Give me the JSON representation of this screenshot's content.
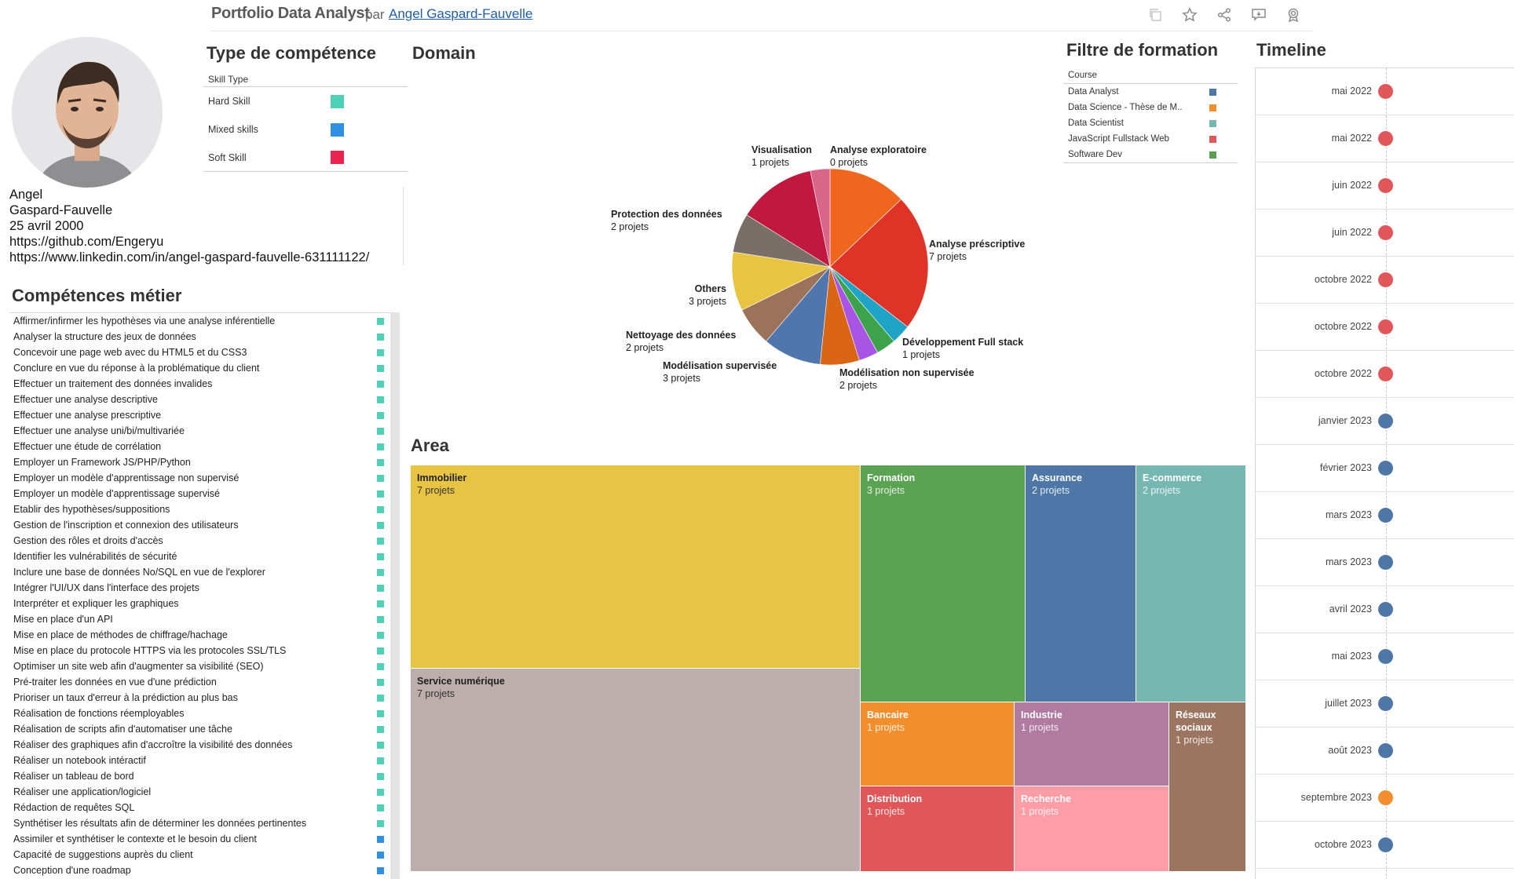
{
  "header": {
    "title": "Portfolio Data Analyst",
    "par": "par",
    "author": "Angel Gaspard-Fauvelle",
    "icons": [
      "copy-icon",
      "star-icon",
      "share-icon",
      "comment-icon",
      "badge-icon"
    ]
  },
  "profile": {
    "first_name": "Angel",
    "last_name": "Gaspard-Fauvelle",
    "birth_date": "25 avril 2000",
    "github": "https://github.com/Engeryu",
    "linkedin": "https://www.linkedin.com/in/angel-gaspard-fauvelle-631111122/"
  },
  "skill_type": {
    "title": "Type de compétence",
    "header": "Skill Type",
    "items": [
      {
        "label": "Hard Skill",
        "color": "#4fd1b8"
      },
      {
        "label": "Mixed skills",
        "color": "#2f8fe0"
      },
      {
        "label": "Soft Skill",
        "color": "#e8244f"
      }
    ]
  },
  "competences": {
    "title": "Compétences métier",
    "hard_color": "#4fd1b8",
    "mixed_color": "#2f8fe0",
    "items": [
      {
        "label": "Affirmer/infirmer les hypothèses via une analyse inférentielle",
        "type": "hard"
      },
      {
        "label": "Analyser la structure des jeux de données",
        "type": "hard"
      },
      {
        "label": "Concevoir une page web avec du HTML5 et du CSS3",
        "type": "hard"
      },
      {
        "label": "Conclure en vue du réponse à la problématique du client",
        "type": "hard"
      },
      {
        "label": "Effectuer un traitement des données invalides",
        "type": "hard"
      },
      {
        "label": "Effectuer une analyse descriptive",
        "type": "hard"
      },
      {
        "label": "Effectuer une analyse prescriptive",
        "type": "hard"
      },
      {
        "label": "Effectuer une analyse uni/bi/multivariée",
        "type": "hard"
      },
      {
        "label": "Effectuer une étude de corrélation",
        "type": "hard"
      },
      {
        "label": "Employer un Framework JS/PHP/Python",
        "type": "hard"
      },
      {
        "label": "Employer un modèle d'apprentissage non supervisé",
        "type": "hard"
      },
      {
        "label": "Employer un modèle d'apprentissage supervisé",
        "type": "hard"
      },
      {
        "label": "Etablir des hypothèses/suppositions",
        "type": "hard"
      },
      {
        "label": "Gestion de l'inscription et connexion des utilisateurs",
        "type": "hard"
      },
      {
        "label": "Gestion des rôles et droits d'accès",
        "type": "hard"
      },
      {
        "label": "Identifier les vulnérabilités de sécurité",
        "type": "hard"
      },
      {
        "label": "Inclure une base de données No/SQL en vue de l'explorer",
        "type": "hard"
      },
      {
        "label": "Intégrer l'UI/UX dans l'interface des projets",
        "type": "hard"
      },
      {
        "label": "Interpréter et expliquer les graphiques",
        "type": "hard"
      },
      {
        "label": "Mise en place d'un API",
        "type": "hard"
      },
      {
        "label": "Mise en place de méthodes de chiffrage/hachage",
        "type": "hard"
      },
      {
        "label": "Mise en place du protocole HTTPS via les protocoles SSL/TLS",
        "type": "hard"
      },
      {
        "label": "Optimiser un site web afin d'augmenter sa visibilité (SEO)",
        "type": "hard"
      },
      {
        "label": "Pré-traiter les données en vue d'une prédiction",
        "type": "hard"
      },
      {
        "label": "Prioriser un taux d'erreur à la prédiction au plus bas",
        "type": "hard"
      },
      {
        "label": "Réalisation de fonctions réemployables",
        "type": "hard"
      },
      {
        "label": "Réalisation de scripts afin d'automatiser une tâche",
        "type": "hard"
      },
      {
        "label": "Réaliser des graphiques afin d'accroître la visibilité des données",
        "type": "hard"
      },
      {
        "label": "Réaliser un notebook intéractif",
        "type": "hard"
      },
      {
        "label": "Réaliser un tableau de bord",
        "type": "hard"
      },
      {
        "label": "Réaliser une application/logiciel",
        "type": "hard"
      },
      {
        "label": "Rédaction de requêtes SQL",
        "type": "hard"
      },
      {
        "label": "Synthétiser les résultats afin de déterminer les données pertinentes",
        "type": "hard"
      },
      {
        "label": "Assimiler et synthétiser le contexte et le besoin du client",
        "type": "mixed"
      },
      {
        "label": "Capacité de suggestions auprès du client",
        "type": "mixed"
      },
      {
        "label": "Conception d'une roadmap",
        "type": "mixed"
      }
    ]
  },
  "domain": {
    "title": "Domain"
  },
  "chart_data": [
    {
      "type": "pie",
      "slices": [
        {
          "name": "Analyse exploratoire",
          "value": 4,
          "label": "0 projets",
          "color": "#f0661f"
        },
        {
          "name": "Analyse préscriptive",
          "value": 7,
          "label": "7 projets",
          "color": "#e03327"
        },
        {
          "name": "Développement Full stack",
          "value": 1,
          "label": "1 projets",
          "color": "#1fa3c6"
        },
        {
          "name": "",
          "value": 1,
          "label": "",
          "color": "#3ca34b"
        },
        {
          "name": "",
          "value": 1,
          "label": "",
          "color": "#a855e6"
        },
        {
          "name": "Modélisation non supervisée",
          "value": 2,
          "label": "2 projets",
          "color": "#d96515"
        },
        {
          "name": "Modélisation supervisée",
          "value": 3,
          "label": "3 projets",
          "color": "#4f76ad"
        },
        {
          "name": "Nettoyage des données",
          "value": 2,
          "label": "2 projets",
          "color": "#9b735a"
        },
        {
          "name": "Others",
          "value": 3,
          "label": "3 projets",
          "color": "#e8c440"
        },
        {
          "name": "Protection des données",
          "value": 2,
          "label": "2 projets",
          "color": "#7a6e69"
        },
        {
          "name": "",
          "value": 4,
          "label": "",
          "color": "#c0183f"
        },
        {
          "name": "Visualisation",
          "value": 1,
          "label": "1 projets",
          "color": "#d9668a"
        }
      ]
    },
    {
      "type": "treemap",
      "title": "Area",
      "items": [
        {
          "name": "Immobilier",
          "value": 7,
          "label": "7 projets",
          "color": "#e8c444"
        },
        {
          "name": "Service numérique",
          "value": 7,
          "label": "7 projets",
          "color": "#bbaeac"
        },
        {
          "name": "Formation",
          "value": 3,
          "label": "3 projets",
          "color": "#5aa352"
        },
        {
          "name": "Assurance",
          "value": 2,
          "label": "2 projets",
          "color": "#4e77a8"
        },
        {
          "name": "E-commerce",
          "value": 2,
          "label": "2 projets",
          "color": "#77b7b1"
        },
        {
          "name": "Bancaire",
          "value": 1,
          "label": "1 projets",
          "color": "#f28e2c"
        },
        {
          "name": "Industrie",
          "value": 1,
          "label": "1 projets",
          "color": "#b07aa1"
        },
        {
          "name": "Réseaux sociaux",
          "value": 1,
          "label": "1 projets",
          "color": "#9c7561"
        },
        {
          "name": "Distribution",
          "value": 1,
          "label": "1 projets",
          "color": "#e15759"
        },
        {
          "name": "Recherche",
          "value": 1,
          "label": "1 projets",
          "color": "#ff9da7"
        }
      ]
    }
  ],
  "formation": {
    "title": "Filtre de formation",
    "header": "Course",
    "items": [
      {
        "label": "Data Analyst",
        "color": "#4e77a8"
      },
      {
        "label": "Data Science - Thèse de M..",
        "color": "#f28e2c"
      },
      {
        "label": "Data Scientist",
        "color": "#76b7b2"
      },
      {
        "label": "JavaScript Fullstack Web",
        "color": "#e15759"
      },
      {
        "label": "Software Dev",
        "color": "#59a14f"
      }
    ]
  },
  "timeline": {
    "title": "Timeline",
    "items": [
      {
        "date": "mai 2022",
        "color": "#e15759"
      },
      {
        "date": "mai 2022",
        "color": "#e15759"
      },
      {
        "date": "juin 2022",
        "color": "#e15759"
      },
      {
        "date": "juin 2022",
        "color": "#e15759"
      },
      {
        "date": "octobre 2022",
        "color": "#e15759"
      },
      {
        "date": "octobre 2022",
        "color": "#e15759"
      },
      {
        "date": "octobre 2022",
        "color": "#e15759"
      },
      {
        "date": "janvier 2023",
        "color": "#4e77a8"
      },
      {
        "date": "février 2023",
        "color": "#4e77a8"
      },
      {
        "date": "mars 2023",
        "color": "#4e77a8"
      },
      {
        "date": "mars 2023",
        "color": "#4e77a8"
      },
      {
        "date": "avril 2023",
        "color": "#4e77a8"
      },
      {
        "date": "mai 2023",
        "color": "#4e77a8"
      },
      {
        "date": "juillet 2023",
        "color": "#4e77a8"
      },
      {
        "date": "août 2023",
        "color": "#4e77a8"
      },
      {
        "date": "septembre 2023",
        "color": "#f28e2c"
      },
      {
        "date": "octobre 2023",
        "color": "#4e77a8"
      }
    ]
  }
}
